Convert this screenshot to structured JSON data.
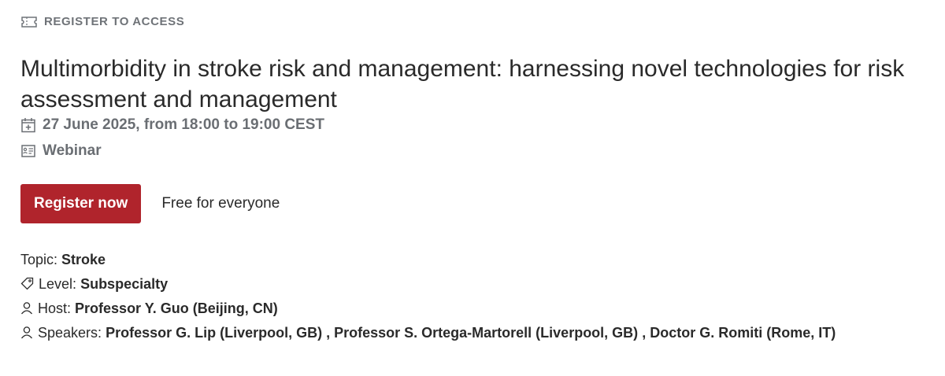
{
  "access": {
    "icon": "ticket-icon",
    "label": "REGISTER TO ACCESS"
  },
  "event": {
    "title": "Multimorbidity in stroke risk and management: harnessing novel technologies for risk assessment and management",
    "date_icon": "calendar-icon",
    "date_text": "27 June 2025, from 18:00 to 19:00 CEST",
    "type_icon": "webinar-icon",
    "type_text": "Webinar"
  },
  "cta": {
    "register_label": "Register now",
    "price_text": "Free for everyone",
    "button_color": "#b0242c"
  },
  "details": {
    "topic_label": "Topic:",
    "topic_value": "Stroke",
    "level_icon": "tag-icon",
    "level_label": "Level:",
    "level_value": "Subspecialty",
    "host_icon": "person-icon",
    "host_label": "Host:",
    "host_value": "Professor Y. Guo (Beijing, CN)",
    "speakers_icon": "person-icon",
    "speakers_label": "Speakers:",
    "speakers": [
      "Professor G. Lip (Liverpool, GB)",
      "Professor S. Ortega-Martorell (Liverpool, GB)",
      "Doctor G. Romiti (Rome, IT)"
    ],
    "speaker_separator": " , "
  }
}
